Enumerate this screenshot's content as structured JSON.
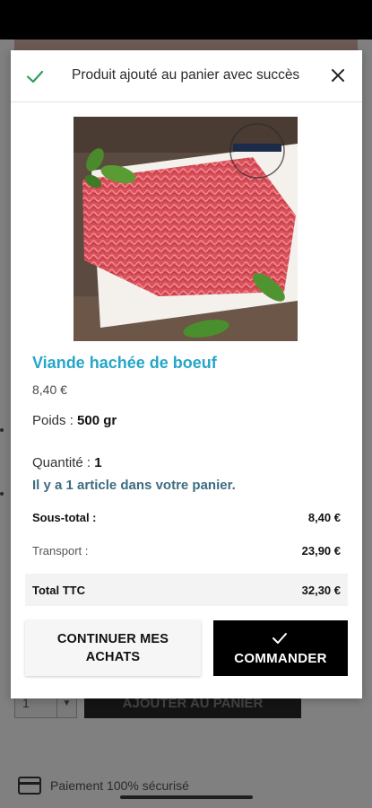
{
  "background": {
    "add_to_cart_label": "AJOUTER AU PANIER",
    "quantity_value": "1",
    "secure_payment": "Paiement 100% sécurisé"
  },
  "modal": {
    "header_message": "Produit ajouté au panier avec succès",
    "product": {
      "name": "Viande hachée de boeuf",
      "price": "8,40 €",
      "weight_label": "Poids : ",
      "weight_value": "500 gr",
      "quantity_label": "Quantité : ",
      "quantity_value": "1",
      "image_icon": "minced-beef-photo"
    },
    "cart_summary": "Il y a 1 article dans votre panier.",
    "totals": {
      "subtotal_label": "Sous-total :",
      "subtotal_value": "8,40 €",
      "shipping_label": "Transport :",
      "shipping_value": "23,90 €",
      "total_label": "Total TTC",
      "total_value": "32,30 €"
    },
    "buttons": {
      "continue_line1": "CONTINUER MES",
      "continue_line2": "ACHATS",
      "order_label": "COMMANDER"
    }
  },
  "colors": {
    "accent": "#26a6c7",
    "success_check": "#2e9e5b",
    "cart_summary": "#3e6d82",
    "order_button": "#000000"
  }
}
